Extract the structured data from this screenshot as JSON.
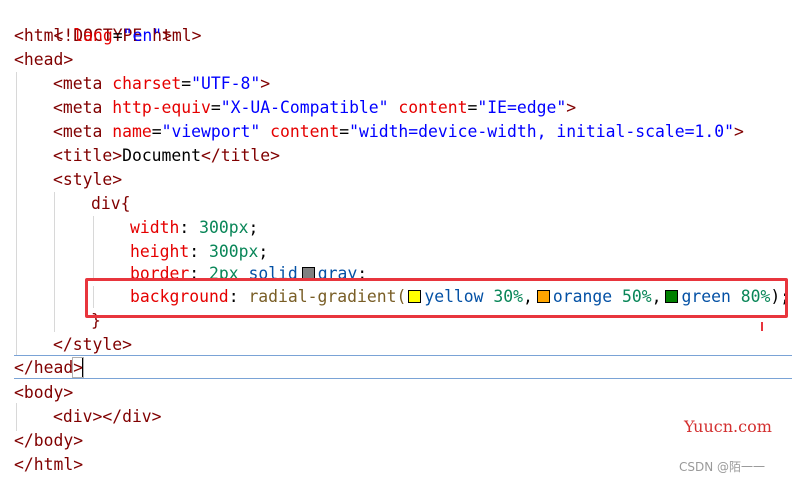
{
  "code": {
    "doctype": "<!DOCTYPE html>",
    "html_open_tag": "<html",
    "html_lang_attr": "lang",
    "html_lang_val": "\"en\"",
    "tag_close": ">",
    "head_open": "<head>",
    "meta_tag": "<meta",
    "charset_attr": "charset",
    "charset_val": "\"UTF-8\"",
    "http_equiv_attr": "http-equiv",
    "http_equiv_val": "\"X-UA-Compatible\"",
    "content_attr": "content",
    "content_ie_val": "\"IE=edge\"",
    "name_attr": "name",
    "name_val": "\"viewport\"",
    "content_vp_val": "\"width=device-width, initial-scale=1.0\"",
    "title_open": "<title>",
    "title_text": "Document",
    "title_close": "</title>",
    "style_open": "<style>",
    "selector": "div{",
    "width_prop": "width",
    "width_val": "300px",
    "height_prop": "height",
    "height_val": "300px",
    "border_prop": "border",
    "border_num": "2px",
    "border_kw": "solid",
    "border_color": "gray",
    "bg_prop": "background",
    "bg_fn": "radial-gradient(",
    "yellow_word": "yellow",
    "yellow_pct": "30%",
    "orange_word": "orange",
    "orange_pct": "50%",
    "green_word": "green",
    "green_pct": "80%",
    "bg_end": ");",
    "close_brace": "}",
    "style_close": "</style>",
    "head_close_a": "</head",
    "head_close_b": ">",
    "body_open": "<body>",
    "div_line": "<div></div>",
    "body_close": "</body>",
    "html_close": "</html>",
    "colon": ":",
    "semicolon": ";",
    "comma": ","
  },
  "swatches": {
    "gray": "#808080",
    "yellow": "#ffff00",
    "orange": "#ffa500",
    "green": "#008000"
  },
  "watermark": {
    "brand": "Yuucn.com",
    "csdn": "CSDN @陌一一"
  }
}
